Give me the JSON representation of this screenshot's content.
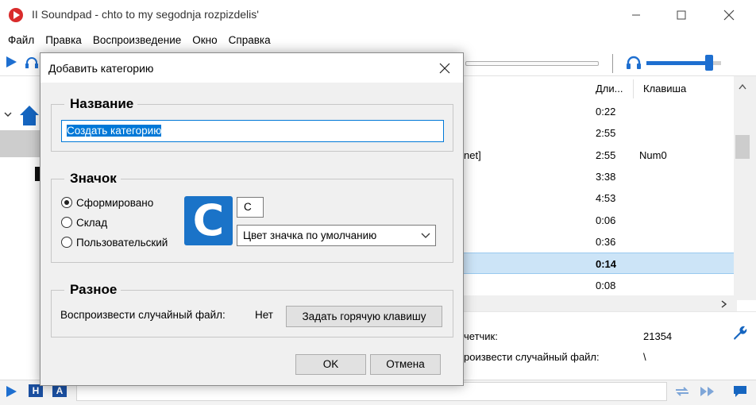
{
  "window": {
    "title": "II  Soundpad - chto to my segodnja rozpizdelis'",
    "menu": [
      "Файл",
      "Правка",
      "Воспроизведение",
      "Окно",
      "Справка"
    ]
  },
  "table": {
    "columns": {
      "duration": "Дли...",
      "hotkey": "Клавиша"
    },
    "rows": [
      {
        "title": "",
        "duration": "0:22",
        "hotkey": ""
      },
      {
        "title": "",
        "duration": "2:55",
        "hotkey": ""
      },
      {
        "title": "net]",
        "duration": "2:55",
        "hotkey": "Num0"
      },
      {
        "title": "",
        "duration": "3:38",
        "hotkey": ""
      },
      {
        "title": "",
        "duration": "4:53",
        "hotkey": ""
      },
      {
        "title": "",
        "duration": "0:06",
        "hotkey": ""
      },
      {
        "title": "",
        "duration": "0:36",
        "hotkey": ""
      },
      {
        "title": "",
        "duration": "0:14",
        "hotkey": "",
        "selected": true
      },
      {
        "title": "",
        "duration": "0:08",
        "hotkey": ""
      }
    ]
  },
  "info": {
    "counter_label": "четчик:",
    "counter_value": "21354",
    "random_label": "роизвести случайный файл:",
    "random_value": "\\"
  },
  "volume": {
    "level": 0.85
  },
  "colors": {
    "accent": "#0078d7",
    "tile": "#1a73c8",
    "selection": "#cce4f7"
  },
  "dialog": {
    "title": "Добавить категорию",
    "name_group": {
      "legend": "Название",
      "value": "Создать категорию"
    },
    "icon_group": {
      "legend": "Значок",
      "options": [
        "Сформировано",
        "Склад",
        "Пользовательский"
      ],
      "selected": 0,
      "letter": "C",
      "letter_input": "C",
      "color_select": "Цвет значка по умолчанию"
    },
    "misc_group": {
      "legend": "Разное",
      "random_label": "Воспроизвести случайный файл:",
      "random_value": "Нет",
      "hotkey_button": "Задать горячую клавишу"
    },
    "ok": "OK",
    "cancel": "Отмена"
  }
}
